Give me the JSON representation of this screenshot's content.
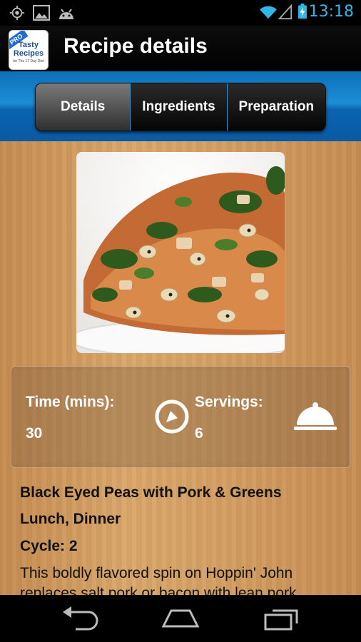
{
  "status_bar": {
    "time": "13:18",
    "icons": [
      "gps-icon",
      "picture-icon",
      "android-icon",
      "wifi-icon",
      "signal-icon",
      "battery-icon"
    ]
  },
  "action_bar": {
    "app_icon": {
      "badge": "PRO",
      "line1": "Tasty",
      "line2": "Recipes",
      "line3": "for The 17 Day Diet"
    },
    "title": "Recipe details"
  },
  "tabs": [
    {
      "label": "Details",
      "active": true
    },
    {
      "label": "Ingredients",
      "active": false
    },
    {
      "label": "Preparation",
      "active": false
    }
  ],
  "info": {
    "time_label": "Time (mins):",
    "time_value": "30",
    "servings_label": "Servings:",
    "servings_value": "6"
  },
  "recipe": {
    "name": "Black Eyed Peas with Pork & Greens",
    "meals": "Lunch, Dinner",
    "cycle": "Cycle: 2",
    "description": "This boldly flavored spin on Hoppin' John replaces salt pork or bacon with lean pork"
  },
  "colors": {
    "accent": "#33b5e5",
    "tab_band": "#1c8ed6"
  }
}
